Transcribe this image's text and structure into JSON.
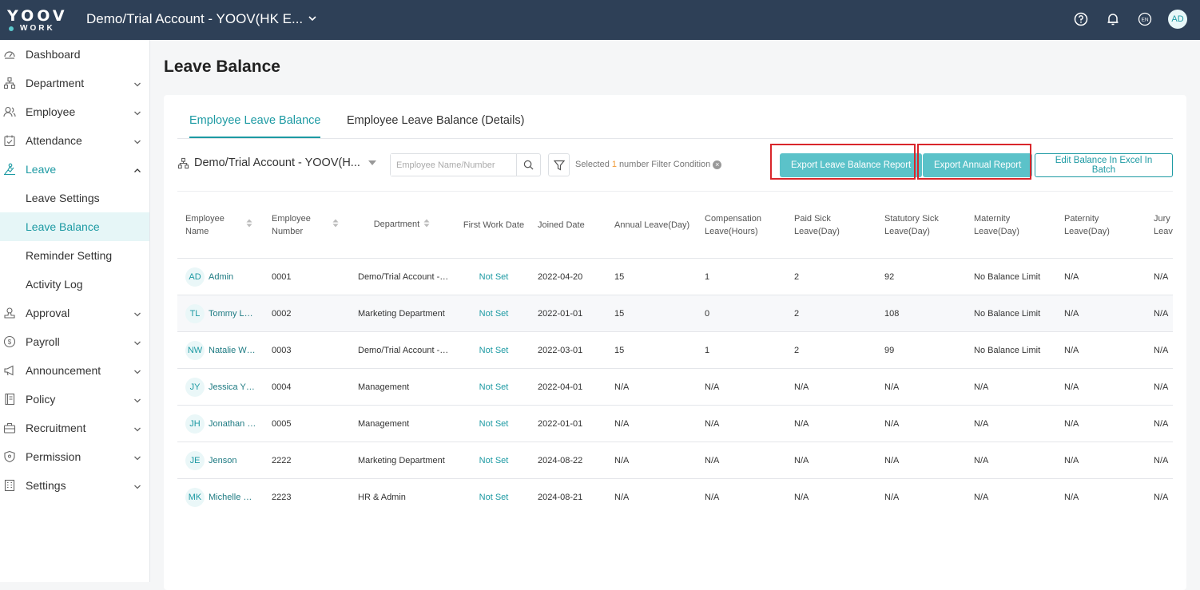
{
  "topbar": {
    "logo_line1": "YOOV",
    "logo_line2": "WORK",
    "account_name": "Demo/Trial Account - YOOV(HK E...",
    "icons": [
      "help-icon",
      "bell-icon",
      "language-icon"
    ],
    "language_label": "EN",
    "user_initials": "AD"
  },
  "sidebar": {
    "items": [
      {
        "label": "Dashboard",
        "icon": "dashboard-icon"
      },
      {
        "label": "Department",
        "icon": "department-icon"
      },
      {
        "label": "Employee",
        "icon": "employee-icon"
      },
      {
        "label": "Attendance",
        "icon": "attendance-icon"
      },
      {
        "label": "Leave",
        "icon": "leave-icon"
      },
      {
        "label": "Leave Settings"
      },
      {
        "label": "Leave Balance"
      },
      {
        "label": "Reminder Setting"
      },
      {
        "label": "Activity Log"
      },
      {
        "label": "Approval",
        "icon": "approval-icon"
      },
      {
        "label": "Payroll",
        "icon": "payroll-icon"
      },
      {
        "label": "Announcement",
        "icon": "announcement-icon"
      },
      {
        "label": "Policy",
        "icon": "policy-icon"
      },
      {
        "label": "Recruitment",
        "icon": "recruitment-icon"
      },
      {
        "label": "Permission",
        "icon": "permission-icon"
      },
      {
        "label": "Settings",
        "icon": "settings-icon"
      }
    ]
  },
  "page": {
    "title": "Leave Balance",
    "tabs": [
      "Employee Leave Balance",
      "Employee Leave Balance (Details)"
    ]
  },
  "toolbar": {
    "org_select": "Demo/Trial Account - YOOV(H...",
    "search_placeholder": "Employee Name/Number",
    "filter_prefix": "Selected",
    "filter_count": "1",
    "filter_suffix": "number Filter Condition",
    "export_balance": "Export Leave Balance Report",
    "export_annual": "Export Annual Report",
    "edit_batch": "Edit Balance In Excel In Batch"
  },
  "table": {
    "headers": [
      [
        "Employee",
        "Name"
      ],
      [
        "Employee",
        "Number"
      ],
      [
        "Department"
      ],
      [
        "First Work Date"
      ],
      [
        "Joined Date"
      ],
      [
        "Annual Leave(Day)"
      ],
      [
        "Compensation",
        "Leave(Hours)"
      ],
      [
        "Paid Sick",
        "Leave(Day)"
      ],
      [
        "Statutory Sick",
        "Leave(Day)"
      ],
      [
        "Maternity",
        "Leave(Day)"
      ],
      [
        "Paternity",
        "Leave(Day)"
      ],
      [
        "Jury",
        "Leav"
      ]
    ],
    "rows": [
      {
        "initials": "AD",
        "name": "Admin",
        "number": "0001",
        "department": "Demo/Trial Account -…",
        "first_work": "Not Set",
        "joined": "2022-04-20",
        "annual": "15",
        "comp": "1",
        "paid_sick": "2",
        "stat_sick": "92",
        "maternity": "No Balance Limit",
        "paternity": "N/A",
        "jury": "N/A"
      },
      {
        "initials": "TL",
        "name": "Tommy L…",
        "number": "0002",
        "department": "Marketing Department",
        "first_work": "Not Set",
        "joined": "2022-01-01",
        "annual": "15",
        "comp": "0",
        "paid_sick": "2",
        "stat_sick": "108",
        "maternity": "No Balance Limit",
        "paternity": "N/A",
        "jury": "N/A"
      },
      {
        "initials": "NW",
        "name": "Natalie W…",
        "number": "0003",
        "department": "Demo/Trial Account -…",
        "first_work": "Not Set",
        "joined": "2022-03-01",
        "annual": "15",
        "comp": "1",
        "paid_sick": "2",
        "stat_sick": "99",
        "maternity": "No Balance Limit",
        "paternity": "N/A",
        "jury": "N/A"
      },
      {
        "initials": "JY",
        "name": "Jessica Y…",
        "number": "0004",
        "department": "Management",
        "first_work": "Not Set",
        "joined": "2022-04-01",
        "annual": "N/A",
        "comp": "N/A",
        "paid_sick": "N/A",
        "stat_sick": "N/A",
        "maternity": "N/A",
        "paternity": "N/A",
        "jury": "N/A"
      },
      {
        "initials": "JH",
        "name": "Jonathan …",
        "number": "0005",
        "department": "Management",
        "first_work": "Not Set",
        "joined": "2022-01-01",
        "annual": "N/A",
        "comp": "N/A",
        "paid_sick": "N/A",
        "stat_sick": "N/A",
        "maternity": "N/A",
        "paternity": "N/A",
        "jury": "N/A"
      },
      {
        "initials": "JE",
        "name": "Jenson",
        "number": "2222",
        "department": "Marketing Department",
        "first_work": "Not Set",
        "joined": "2024-08-22",
        "annual": "N/A",
        "comp": "N/A",
        "paid_sick": "N/A",
        "stat_sick": "N/A",
        "maternity": "N/A",
        "paternity": "N/A",
        "jury": "N/A"
      },
      {
        "initials": "MK",
        "name": "Michelle …",
        "number": "2223",
        "department": "HR & Admin",
        "first_work": "Not Set",
        "joined": "2024-08-21",
        "annual": "N/A",
        "comp": "N/A",
        "paid_sick": "N/A",
        "stat_sick": "N/A",
        "maternity": "N/A",
        "paternity": "N/A",
        "jury": "N/A"
      }
    ]
  },
  "colors": {
    "topbar": "#2e4057",
    "accent": "#1d9aa3",
    "button": "#5bc2c9",
    "highlight": "#d9262b"
  }
}
